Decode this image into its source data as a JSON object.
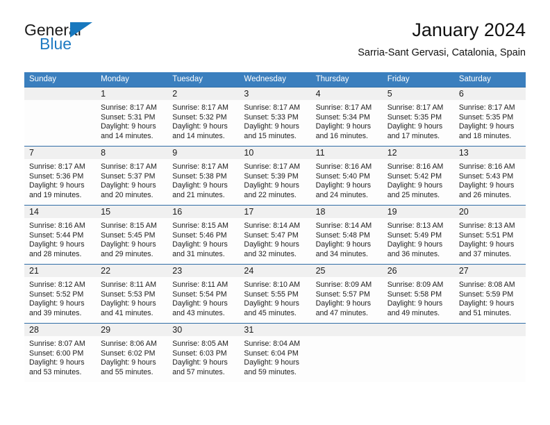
{
  "brand": {
    "name_part1": "General",
    "name_part2": "Blue",
    "triangle_icon": "triangle-icon",
    "accent_color": "#1878be"
  },
  "header": {
    "title": "January 2024",
    "subtitle": "Sarria-Sant Gervasi, Catalonia, Spain"
  },
  "theme": {
    "header_row_bg": "#3b7fbe",
    "day_number_bg": "#f0f0f0",
    "row_border": "#2f6da6",
    "text": "#1c1c1c"
  },
  "weekdays": [
    "Sunday",
    "Monday",
    "Tuesday",
    "Wednesday",
    "Thursday",
    "Friday",
    "Saturday"
  ],
  "weeks": [
    [
      {
        "day": "",
        "sunrise": "",
        "sunset": "",
        "daylight_line1": "",
        "daylight_line2": ""
      },
      {
        "day": "1",
        "sunrise": "Sunrise: 8:17 AM",
        "sunset": "Sunset: 5:31 PM",
        "daylight_line1": "Daylight: 9 hours",
        "daylight_line2": "and 14 minutes."
      },
      {
        "day": "2",
        "sunrise": "Sunrise: 8:17 AM",
        "sunset": "Sunset: 5:32 PM",
        "daylight_line1": "Daylight: 9 hours",
        "daylight_line2": "and 14 minutes."
      },
      {
        "day": "3",
        "sunrise": "Sunrise: 8:17 AM",
        "sunset": "Sunset: 5:33 PM",
        "daylight_line1": "Daylight: 9 hours",
        "daylight_line2": "and 15 minutes."
      },
      {
        "day": "4",
        "sunrise": "Sunrise: 8:17 AM",
        "sunset": "Sunset: 5:34 PM",
        "daylight_line1": "Daylight: 9 hours",
        "daylight_line2": "and 16 minutes."
      },
      {
        "day": "5",
        "sunrise": "Sunrise: 8:17 AM",
        "sunset": "Sunset: 5:35 PM",
        "daylight_line1": "Daylight: 9 hours",
        "daylight_line2": "and 17 minutes."
      },
      {
        "day": "6",
        "sunrise": "Sunrise: 8:17 AM",
        "sunset": "Sunset: 5:35 PM",
        "daylight_line1": "Daylight: 9 hours",
        "daylight_line2": "and 18 minutes."
      }
    ],
    [
      {
        "day": "7",
        "sunrise": "Sunrise: 8:17 AM",
        "sunset": "Sunset: 5:36 PM",
        "daylight_line1": "Daylight: 9 hours",
        "daylight_line2": "and 19 minutes."
      },
      {
        "day": "8",
        "sunrise": "Sunrise: 8:17 AM",
        "sunset": "Sunset: 5:37 PM",
        "daylight_line1": "Daylight: 9 hours",
        "daylight_line2": "and 20 minutes."
      },
      {
        "day": "9",
        "sunrise": "Sunrise: 8:17 AM",
        "sunset": "Sunset: 5:38 PM",
        "daylight_line1": "Daylight: 9 hours",
        "daylight_line2": "and 21 minutes."
      },
      {
        "day": "10",
        "sunrise": "Sunrise: 8:17 AM",
        "sunset": "Sunset: 5:39 PM",
        "daylight_line1": "Daylight: 9 hours",
        "daylight_line2": "and 22 minutes."
      },
      {
        "day": "11",
        "sunrise": "Sunrise: 8:16 AM",
        "sunset": "Sunset: 5:40 PM",
        "daylight_line1": "Daylight: 9 hours",
        "daylight_line2": "and 24 minutes."
      },
      {
        "day": "12",
        "sunrise": "Sunrise: 8:16 AM",
        "sunset": "Sunset: 5:42 PM",
        "daylight_line1": "Daylight: 9 hours",
        "daylight_line2": "and 25 minutes."
      },
      {
        "day": "13",
        "sunrise": "Sunrise: 8:16 AM",
        "sunset": "Sunset: 5:43 PM",
        "daylight_line1": "Daylight: 9 hours",
        "daylight_line2": "and 26 minutes."
      }
    ],
    [
      {
        "day": "14",
        "sunrise": "Sunrise: 8:16 AM",
        "sunset": "Sunset: 5:44 PM",
        "daylight_line1": "Daylight: 9 hours",
        "daylight_line2": "and 28 minutes."
      },
      {
        "day": "15",
        "sunrise": "Sunrise: 8:15 AM",
        "sunset": "Sunset: 5:45 PM",
        "daylight_line1": "Daylight: 9 hours",
        "daylight_line2": "and 29 minutes."
      },
      {
        "day": "16",
        "sunrise": "Sunrise: 8:15 AM",
        "sunset": "Sunset: 5:46 PM",
        "daylight_line1": "Daylight: 9 hours",
        "daylight_line2": "and 31 minutes."
      },
      {
        "day": "17",
        "sunrise": "Sunrise: 8:14 AM",
        "sunset": "Sunset: 5:47 PM",
        "daylight_line1": "Daylight: 9 hours",
        "daylight_line2": "and 32 minutes."
      },
      {
        "day": "18",
        "sunrise": "Sunrise: 8:14 AM",
        "sunset": "Sunset: 5:48 PM",
        "daylight_line1": "Daylight: 9 hours",
        "daylight_line2": "and 34 minutes."
      },
      {
        "day": "19",
        "sunrise": "Sunrise: 8:13 AM",
        "sunset": "Sunset: 5:49 PM",
        "daylight_line1": "Daylight: 9 hours",
        "daylight_line2": "and 36 minutes."
      },
      {
        "day": "20",
        "sunrise": "Sunrise: 8:13 AM",
        "sunset": "Sunset: 5:51 PM",
        "daylight_line1": "Daylight: 9 hours",
        "daylight_line2": "and 37 minutes."
      }
    ],
    [
      {
        "day": "21",
        "sunrise": "Sunrise: 8:12 AM",
        "sunset": "Sunset: 5:52 PM",
        "daylight_line1": "Daylight: 9 hours",
        "daylight_line2": "and 39 minutes."
      },
      {
        "day": "22",
        "sunrise": "Sunrise: 8:11 AM",
        "sunset": "Sunset: 5:53 PM",
        "daylight_line1": "Daylight: 9 hours",
        "daylight_line2": "and 41 minutes."
      },
      {
        "day": "23",
        "sunrise": "Sunrise: 8:11 AM",
        "sunset": "Sunset: 5:54 PM",
        "daylight_line1": "Daylight: 9 hours",
        "daylight_line2": "and 43 minutes."
      },
      {
        "day": "24",
        "sunrise": "Sunrise: 8:10 AM",
        "sunset": "Sunset: 5:55 PM",
        "daylight_line1": "Daylight: 9 hours",
        "daylight_line2": "and 45 minutes."
      },
      {
        "day": "25",
        "sunrise": "Sunrise: 8:09 AM",
        "sunset": "Sunset: 5:57 PM",
        "daylight_line1": "Daylight: 9 hours",
        "daylight_line2": "and 47 minutes."
      },
      {
        "day": "26",
        "sunrise": "Sunrise: 8:09 AM",
        "sunset": "Sunset: 5:58 PM",
        "daylight_line1": "Daylight: 9 hours",
        "daylight_line2": "and 49 minutes."
      },
      {
        "day": "27",
        "sunrise": "Sunrise: 8:08 AM",
        "sunset": "Sunset: 5:59 PM",
        "daylight_line1": "Daylight: 9 hours",
        "daylight_line2": "and 51 minutes."
      }
    ],
    [
      {
        "day": "28",
        "sunrise": "Sunrise: 8:07 AM",
        "sunset": "Sunset: 6:00 PM",
        "daylight_line1": "Daylight: 9 hours",
        "daylight_line2": "and 53 minutes."
      },
      {
        "day": "29",
        "sunrise": "Sunrise: 8:06 AM",
        "sunset": "Sunset: 6:02 PM",
        "daylight_line1": "Daylight: 9 hours",
        "daylight_line2": "and 55 minutes."
      },
      {
        "day": "30",
        "sunrise": "Sunrise: 8:05 AM",
        "sunset": "Sunset: 6:03 PM",
        "daylight_line1": "Daylight: 9 hours",
        "daylight_line2": "and 57 minutes."
      },
      {
        "day": "31",
        "sunrise": "Sunrise: 8:04 AM",
        "sunset": "Sunset: 6:04 PM",
        "daylight_line1": "Daylight: 9 hours",
        "daylight_line2": "and 59 minutes."
      },
      {
        "day": "",
        "sunrise": "",
        "sunset": "",
        "daylight_line1": "",
        "daylight_line2": ""
      },
      {
        "day": "",
        "sunrise": "",
        "sunset": "",
        "daylight_line1": "",
        "daylight_line2": ""
      },
      {
        "day": "",
        "sunrise": "",
        "sunset": "",
        "daylight_line1": "",
        "daylight_line2": ""
      }
    ]
  ]
}
